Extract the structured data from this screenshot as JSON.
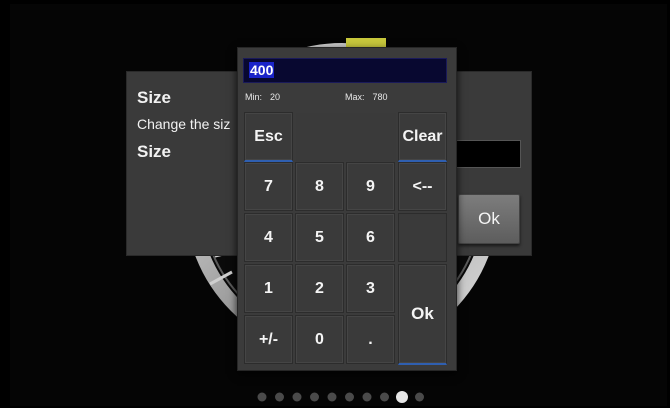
{
  "dialog": {
    "title": "Size",
    "description": "Change the siz",
    "field_label": "Size",
    "ok_label": "Ok"
  },
  "keypad": {
    "value": "400",
    "min_label": "Min:",
    "min_value": "20",
    "max_label": "Max:",
    "max_value": "780",
    "keys": {
      "esc": "Esc",
      "clear": "Clear",
      "k7": "7",
      "k8": "8",
      "k9": "9",
      "backspace": "<--",
      "k4": "4",
      "k5": "5",
      "k6": "6",
      "k1": "1",
      "k2": "2",
      "k3": "3",
      "plusminus": "+/-",
      "k0": "0",
      "dot": ".",
      "ok": "Ok"
    }
  },
  "pager": {
    "page_count": 10,
    "active_page": 9
  },
  "colors": {
    "background": "#000000",
    "panel": "#3b3b3b",
    "display_bg": "#080830",
    "selection": "#1a24c8",
    "accent_line": "#2f5fb0",
    "gauge_highlight": "#c8c83c"
  }
}
